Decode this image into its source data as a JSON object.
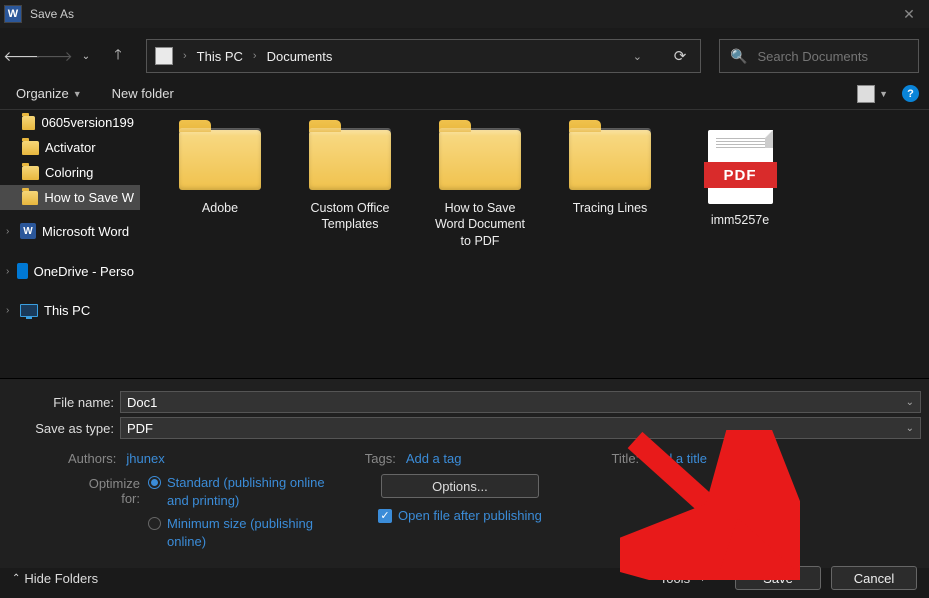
{
  "window": {
    "title": "Save As"
  },
  "nav": {
    "breadcrumb": [
      "This PC",
      "Documents"
    ],
    "search_placeholder": "Search Documents"
  },
  "toolbar": {
    "organize": "Organize",
    "new_folder": "New folder"
  },
  "tree": {
    "items": [
      {
        "label": "0605version199",
        "type": "folder"
      },
      {
        "label": "Activator",
        "type": "folder"
      },
      {
        "label": "Coloring",
        "type": "folder"
      },
      {
        "label": "How to Save W",
        "type": "folder",
        "selected": true
      },
      {
        "label": "Microsoft Word",
        "type": "word",
        "expandable": true
      },
      {
        "label": "OneDrive - Perso",
        "type": "onedrive",
        "expandable": true
      },
      {
        "label": "This PC",
        "type": "pc",
        "expandable": true
      }
    ]
  },
  "files": [
    {
      "name": "Adobe",
      "type": "folder"
    },
    {
      "name": "Custom Office Templates",
      "type": "folder"
    },
    {
      "name": "How to Save Word Document to PDF",
      "type": "folder"
    },
    {
      "name": "Tracing Lines",
      "type": "folder"
    },
    {
      "name": "imm5257e",
      "type": "pdf",
      "badge": "PDF"
    }
  ],
  "form": {
    "file_name_label": "File name:",
    "file_name": "Doc1",
    "save_type_label": "Save as type:",
    "save_type": "PDF",
    "authors_label": "Authors:",
    "authors": "jhunex",
    "tags_label": "Tags:",
    "tags": "Add a tag",
    "title_label": "Title:",
    "title": "Add a title",
    "optimize_label": "Optimize for:",
    "optimize_options": [
      "Standard (publishing online and printing)",
      "Minimum size (publishing online)"
    ],
    "options_btn": "Options...",
    "open_after": "Open file after publishing"
  },
  "footer": {
    "hide_folders": "Hide Folders",
    "tools": "Tools",
    "save": "Save",
    "cancel": "Cancel"
  }
}
